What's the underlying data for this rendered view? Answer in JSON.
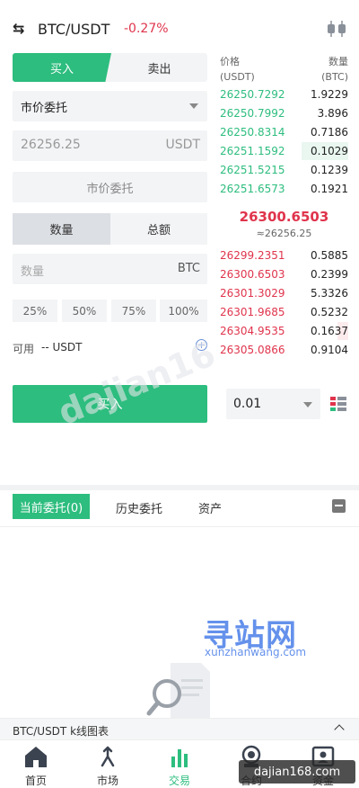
{
  "header": {
    "pair": "BTC/USDT",
    "change": "-0.27%"
  },
  "form": {
    "side_buy": "买入",
    "side_sell": "卖出",
    "order_type": "市价委托",
    "price_value": "26256.25",
    "price_unit": "USDT",
    "market_button": "市价委托",
    "tab_quantity": "数量",
    "tab_total": "总额",
    "quantity_placeholder": "数量",
    "quantity_unit": "BTC",
    "percents": [
      "25%",
      "50%",
      "75%",
      "100%"
    ],
    "available_label": "可用",
    "available_amount": "-- USDT",
    "buy_button": "买入"
  },
  "book": {
    "header_price": "价格",
    "header_price_unit": "(USDT)",
    "header_qty": "数量",
    "header_qty_unit": "(BTC)",
    "bids": [
      {
        "price": "26250.7292",
        "qty": "1.9229"
      },
      {
        "price": "26250.7992",
        "qty": "3.896"
      },
      {
        "price": "26250.8314",
        "qty": "0.7186"
      },
      {
        "price": "26251.1592",
        "qty": "0.1029"
      },
      {
        "price": "26251.5215",
        "qty": "0.1239"
      },
      {
        "price": "26251.6573",
        "qty": "0.1921"
      }
    ],
    "mid_price": "26300.6503",
    "mid_sub": "≈26256.25",
    "asks": [
      {
        "price": "26299.2351",
        "qty": "0.5885"
      },
      {
        "price": "26300.6503",
        "qty": "0.2399"
      },
      {
        "price": "26301.3029",
        "qty": "5.3326"
      },
      {
        "price": "26301.9685",
        "qty": "0.5232"
      },
      {
        "price": "26304.9535",
        "qty": "0.1637"
      },
      {
        "price": "26305.0866",
        "qty": "0.9104"
      }
    ],
    "depth": "0.01"
  },
  "orders": {
    "tab_current": "当前委托(0)",
    "tab_history": "历史委托",
    "tab_assets": "资产"
  },
  "watermark": {
    "title": "寻站网",
    "subtitle": "xunzhanwang.com",
    "diagonal": "dajian16",
    "badge": "dajian168.com"
  },
  "kline": {
    "label": "BTC/USDT k线图表"
  },
  "nav": {
    "home": "首页",
    "market": "市场",
    "trade": "交易",
    "contract": "合约",
    "assets": "资金"
  },
  "colors": {
    "accent": "#2dbd7e",
    "down": "#e0344c"
  }
}
